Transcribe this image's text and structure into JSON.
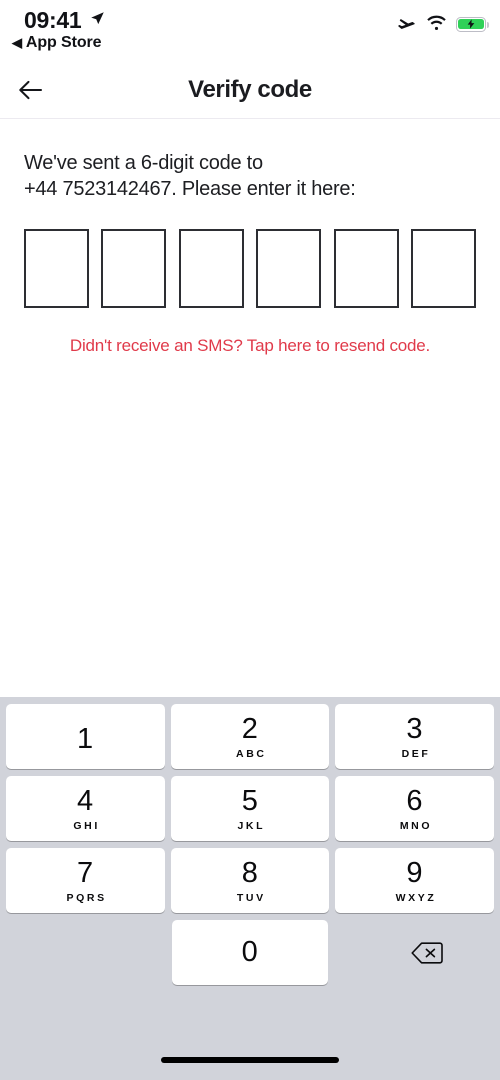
{
  "statusbar": {
    "time": "09:41",
    "location_icon": "location-arrow-icon",
    "back_app_triangle": "◀",
    "back_app_label": "App Store",
    "airplane_icon": "airplane-mode-icon",
    "wifi_icon": "wifi-icon",
    "battery_icon": "battery-charging-icon",
    "battery_color": "#2fd158"
  },
  "navbar": {
    "back_icon": "arrow-left-icon",
    "title": "Verify code"
  },
  "content": {
    "prompt_line1": "We've sent a 6-digit code to",
    "prompt_line2": "+44 7523142467. Please enter it here:",
    "code_length": 6,
    "code_digits": [
      "",
      "",
      "",
      "",
      "",
      ""
    ],
    "code_placeholder": "",
    "resend_text": "Didn't receive an SMS? Tap here to resend code.",
    "resend_color": "#e03a4a"
  },
  "keyboard": {
    "background": "#d1d3da",
    "keys": [
      {
        "digit": "1",
        "letters": ""
      },
      {
        "digit": "2",
        "letters": "ABC"
      },
      {
        "digit": "3",
        "letters": "DEF"
      },
      {
        "digit": "4",
        "letters": "GHI"
      },
      {
        "digit": "5",
        "letters": "JKL"
      },
      {
        "digit": "6",
        "letters": "MNO"
      },
      {
        "digit": "7",
        "letters": "PQRS"
      },
      {
        "digit": "8",
        "letters": "TUV"
      },
      {
        "digit": "9",
        "letters": "WXYZ"
      }
    ],
    "zero_key": "0",
    "delete_icon": "backspace-delete-icon",
    "home_indicator": "home-indicator"
  }
}
